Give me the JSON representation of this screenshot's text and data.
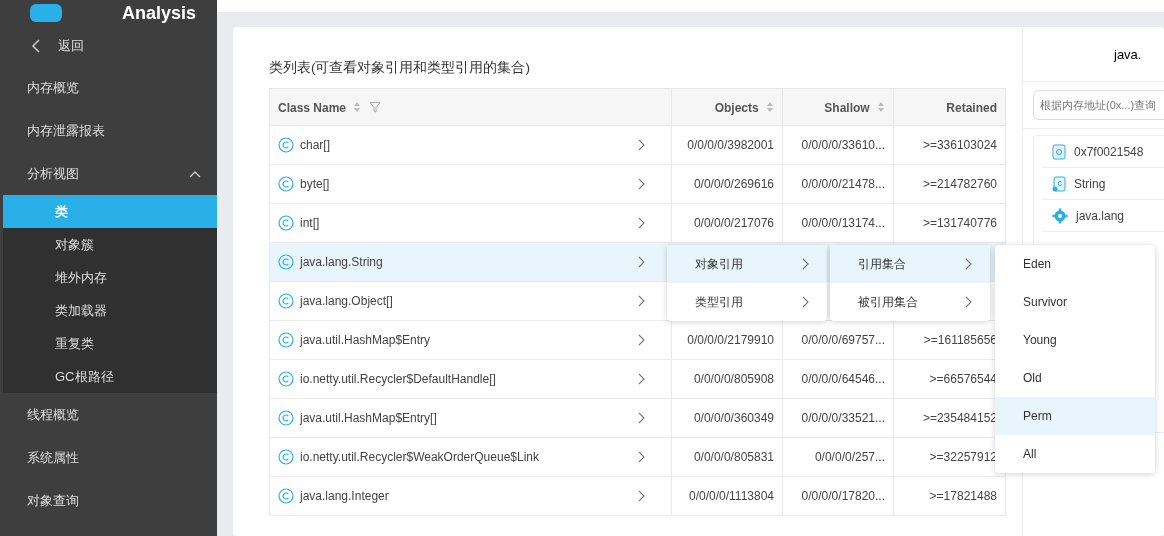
{
  "sidebar": {
    "app_title": "Analysis",
    "back": "返回",
    "items": [
      {
        "label": "内存概览",
        "selected": false
      },
      {
        "label": "内存泄露报表",
        "selected": false
      },
      {
        "label": "分析视图",
        "selected": false,
        "expanded": true,
        "children": [
          {
            "label": "类",
            "selected": true
          },
          {
            "label": "对象簇",
            "selected": false
          },
          {
            "label": "堆外内存",
            "selected": false
          },
          {
            "label": "类加载器",
            "selected": false
          },
          {
            "label": "重复类",
            "selected": false
          },
          {
            "label": "GC根路径",
            "selected": false
          }
        ]
      },
      {
        "label": "线程概览",
        "selected": false
      },
      {
        "label": "系统属性",
        "selected": false
      },
      {
        "label": "对象查询",
        "selected": false
      }
    ]
  },
  "card": {
    "title": "类列表(可查看对象引用和类型引用的集合)"
  },
  "table": {
    "columns": [
      {
        "label": "Class Name",
        "sortable": true,
        "filterable": true
      },
      {
        "label": "Objects",
        "sortable": true,
        "filterable": false
      },
      {
        "label": "Shallow",
        "sortable": true,
        "filterable": false
      },
      {
        "label": "Retained",
        "sortable": false,
        "filterable": false
      }
    ],
    "rows": [
      {
        "name": "char[]",
        "objects": "0/0/0/0/3982001",
        "shallow": "0/0/0/0/33610...",
        "retained": ">=336103024",
        "selected": false
      },
      {
        "name": "byte[]",
        "objects": "0/0/0/0/269616",
        "shallow": "0/0/0/0/21478...",
        "retained": ">=214782760",
        "selected": false
      },
      {
        "name": "int[]",
        "objects": "0/0/0/0/217076",
        "shallow": "0/0/0/0/13174...",
        "retained": ">=131740776",
        "selected": false
      },
      {
        "name": "java.lang.String",
        "selected": true
      },
      {
        "name": "java.lang.Object[]",
        "selected": false
      },
      {
        "name": "java.util.HashMap$Entry",
        "objects": "0/0/0/0/2179910",
        "shallow": "0/0/0/0/69757...",
        "retained": ">=161185656",
        "selected": false
      },
      {
        "name": "io.netty.util.Recycler$DefaultHandle[]",
        "objects": "0/0/0/0/805908",
        "shallow": "0/0/0/0/64546...",
        "retained": ">=66576544",
        "selected": false
      },
      {
        "name": "java.util.HashMap$Entry[]",
        "objects": "0/0/0/0/360349",
        "shallow": "0/0/0/0/33521...",
        "retained": ">=235484152",
        "selected": false
      },
      {
        "name": "io.netty.util.Recycler$WeakOrderQueue$Link",
        "objects": "0/0/0/0/805831",
        "shallow": "0/0/0/0/257...",
        "retained": ">=32257912",
        "selected": false
      },
      {
        "name": "java.lang.Integer",
        "objects": "0/0/0/0/1113804",
        "shallow": "0/0/0/0/17820...",
        "retained": ">=17821488",
        "selected": false
      }
    ]
  },
  "context_menus": [
    {
      "items": [
        {
          "label": "对象引用",
          "selected": true
        },
        {
          "label": "类型引用",
          "selected": false
        }
      ]
    },
    {
      "items": [
        {
          "label": "引用集合",
          "selected": true
        },
        {
          "label": "被引用集合",
          "selected": false
        }
      ]
    },
    {
      "items": [
        {
          "label": "Eden",
          "selected": false
        },
        {
          "label": "Survivor",
          "selected": false
        },
        {
          "label": "Young",
          "selected": false
        },
        {
          "label": "Old",
          "selected": false
        },
        {
          "label": "Perm",
          "selected": true
        },
        {
          "label": "All",
          "selected": false
        }
      ]
    }
  ],
  "detail_panel": {
    "title": "java.",
    "search": {
      "placeholder": "根据内存地址(0x...)查询"
    },
    "items": [
      {
        "kind": "address",
        "label": "0x7f0021548"
      },
      {
        "kind": "class",
        "label": "String"
      },
      {
        "kind": "package",
        "label": "java.lang"
      }
    ]
  }
}
